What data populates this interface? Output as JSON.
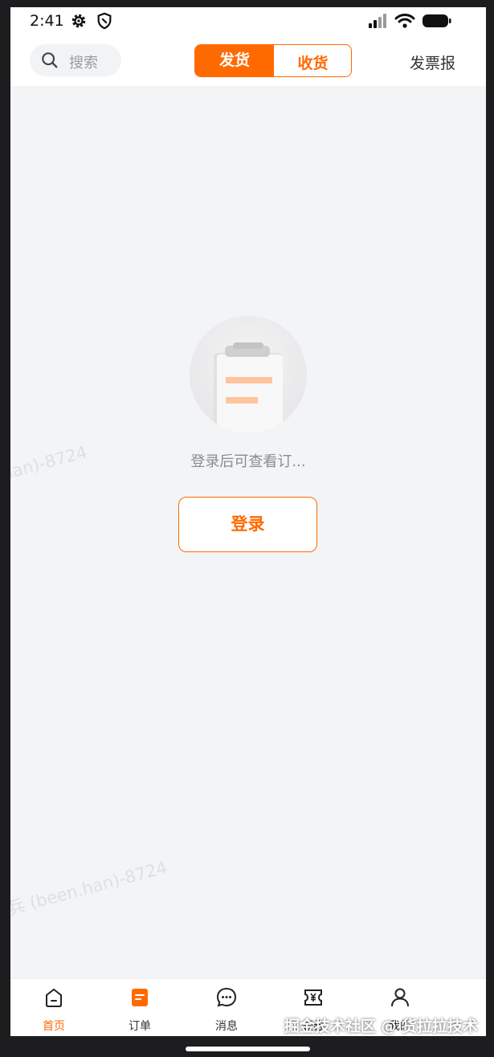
{
  "status_bar": {
    "time": "2:41",
    "icons": [
      "gear-icon",
      "shield-icon",
      "signal-icon",
      "wifi-icon",
      "battery-icon"
    ]
  },
  "header": {
    "search_label": "搜索",
    "segment_ship": "发货",
    "segment_receive": "收货",
    "invoice_label": "发票报"
  },
  "empty_state": {
    "message": "登录后可查看订...",
    "login_label": "登录"
  },
  "watermark": {
    "text_1": "han)-8724",
    "text_2": "兵 (been.han)-8724"
  },
  "tabs": [
    {
      "label": "首页",
      "icon": "home-icon",
      "active": true
    },
    {
      "label": "订单",
      "icon": "order-icon",
      "active": false
    },
    {
      "label": "消息",
      "icon": "message-icon",
      "active": false
    },
    {
      "label": "领券",
      "icon": "coupon-icon",
      "active": false
    },
    {
      "label": "我的",
      "icon": "profile-icon",
      "active": false
    }
  ],
  "credit": "掘金技术社区 @ 货拉拉技术",
  "colors": {
    "accent": "#ff6a00",
    "page_bg": "#f3f4f6",
    "text_muted": "#8a8c92"
  }
}
